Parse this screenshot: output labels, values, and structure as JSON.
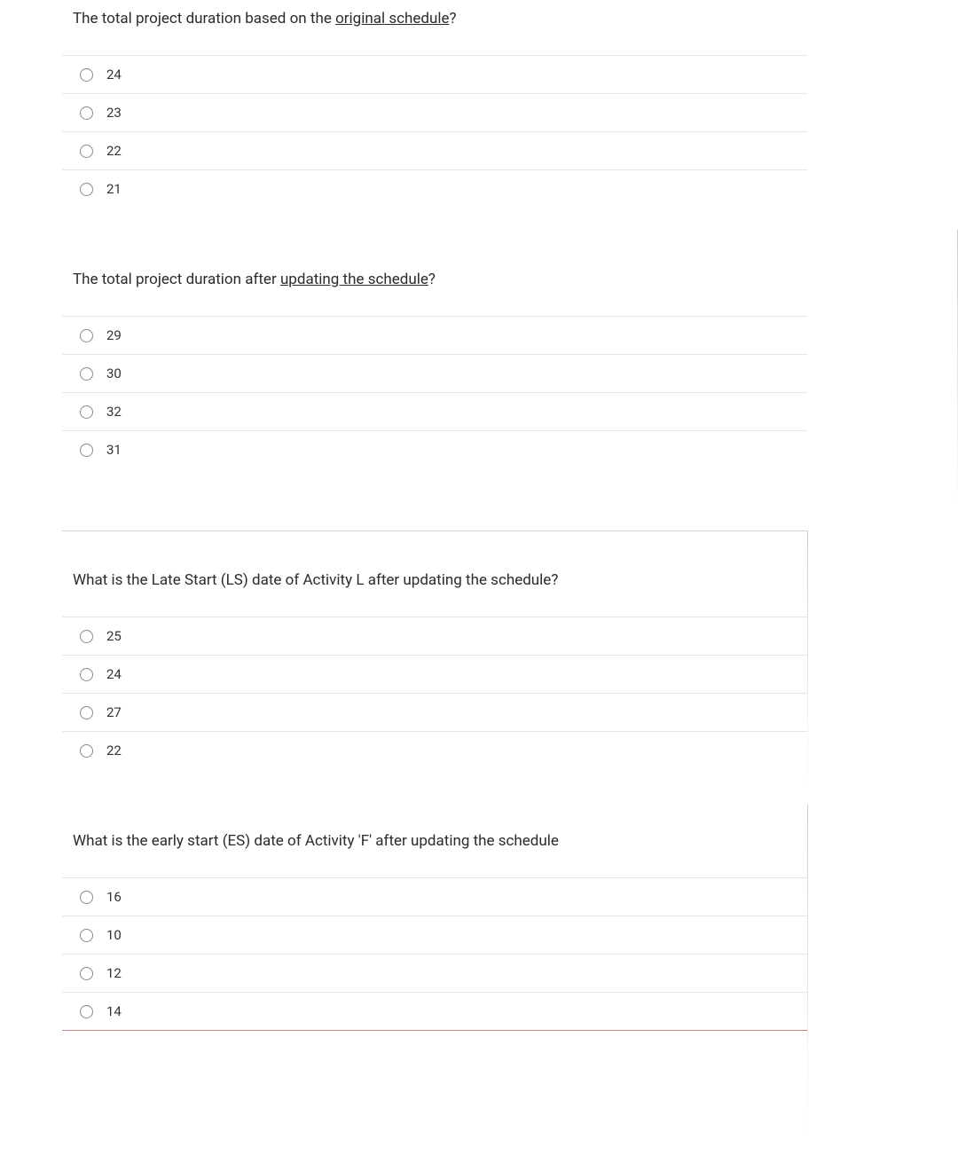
{
  "questions": [
    {
      "prompt_prefix": "The total project duration based on the ",
      "prompt_underline": "original schedule",
      "prompt_suffix": "?",
      "options": [
        "24",
        "23",
        "22",
        "21"
      ]
    },
    {
      "prompt_prefix": "The total project duration after ",
      "prompt_underline": "updating the schedule",
      "prompt_suffix": "?",
      "options": [
        "29",
        "30",
        "32",
        "31"
      ]
    },
    {
      "prompt_prefix": "What is the Late Start (LS) date of Activity L after updating the schedule?",
      "prompt_underline": "",
      "prompt_suffix": "",
      "options": [
        "25",
        "24",
        "27",
        "22"
      ]
    },
    {
      "prompt_prefix": "What is the early start (ES) date of Activity 'F' after updating the schedule",
      "prompt_underline": "",
      "prompt_suffix": "",
      "options": [
        "16",
        "10",
        "12",
        "14"
      ]
    }
  ]
}
